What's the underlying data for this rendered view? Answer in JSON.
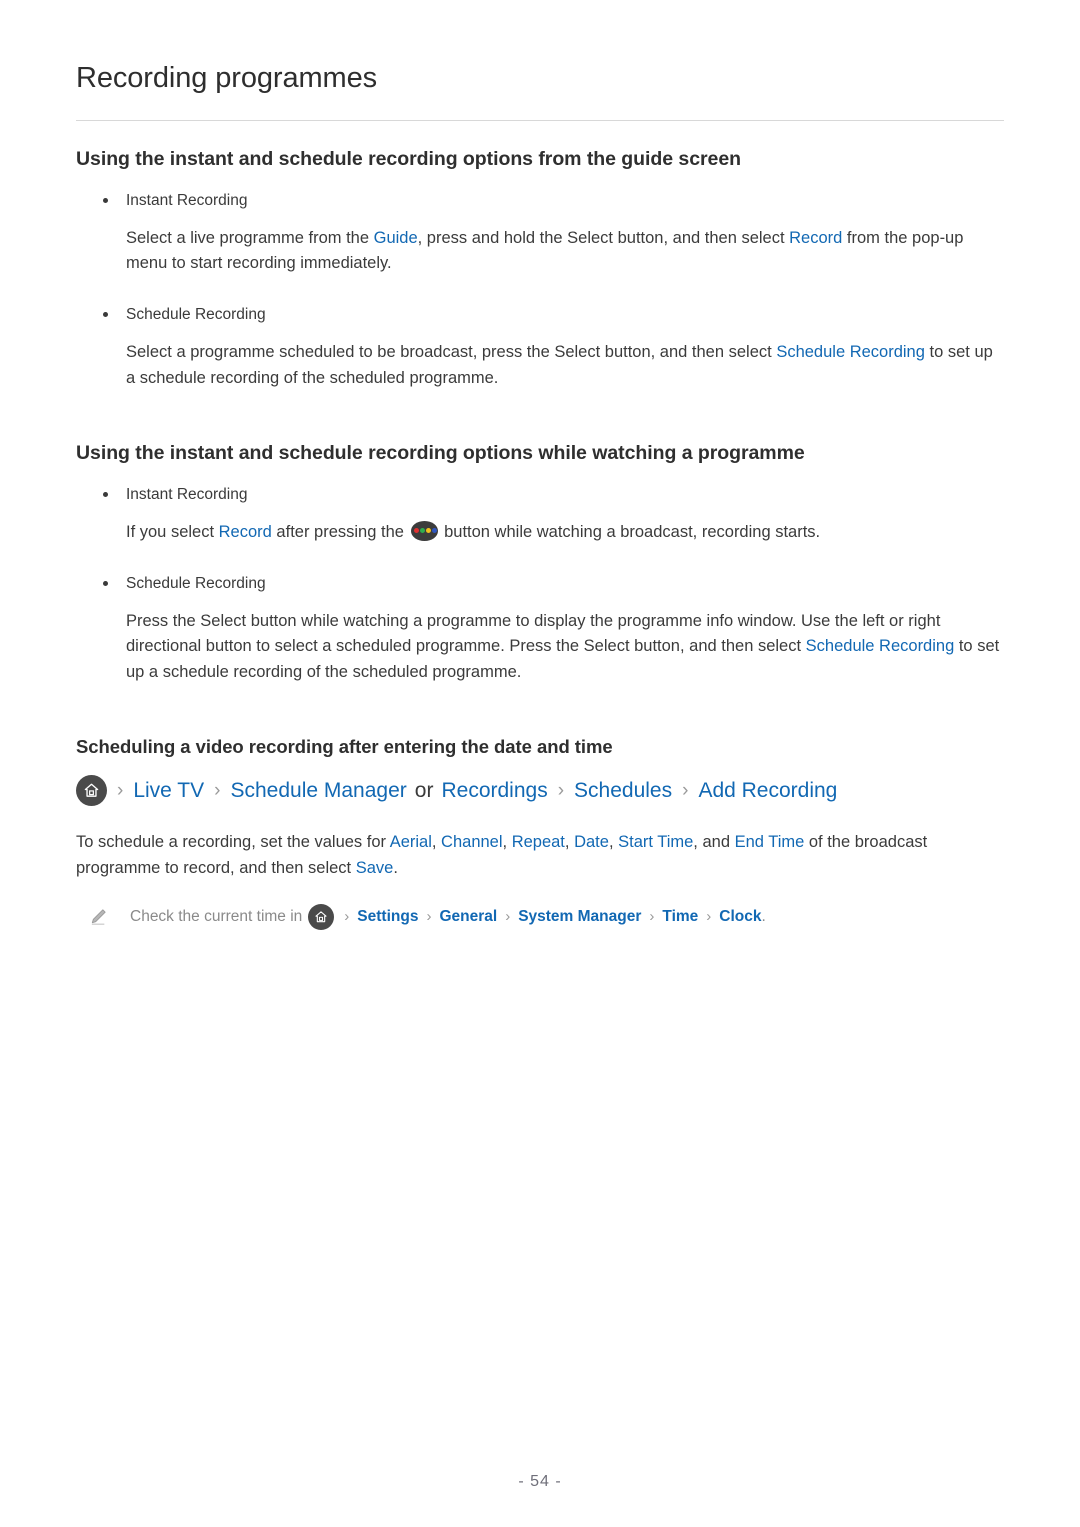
{
  "page": {
    "title": "Recording programmes",
    "footer_page_number": "- 54 -"
  },
  "colors": {
    "link_blue": "#1268b3",
    "body_text": "#3b3b3b",
    "note_gray": "#8a8a8a",
    "icon_circle": "#4a4a4a",
    "dot_red": "#e03030",
    "dot_green": "#2fae4e",
    "dot_yellow": "#f0c020",
    "dot_blue": "#2f56c0"
  },
  "sections": [
    {
      "heading": "Using the instant and schedule recording options from the guide screen",
      "items": [
        {
          "bullet": "Instant Recording",
          "paragraph": {
            "p1": "Select a live programme from the ",
            "link1": "Guide",
            "p2": ", press and hold the Select button, and then select ",
            "link2": "Record",
            "p3": " from the pop-up menu to start recording immediately."
          }
        },
        {
          "bullet": "Schedule Recording",
          "paragraph": {
            "p1": "Select a programme scheduled to be broadcast, press the Select button, and then select ",
            "link1": "Schedule Recording",
            "p2": " to set up a schedule recording of the scheduled programme."
          }
        }
      ]
    },
    {
      "heading": "Using the instant and schedule recording options while watching a programme",
      "items": [
        {
          "bullet": "Instant Recording",
          "paragraph": {
            "p1": "If you select ",
            "link1": "Record",
            "p2": " after pressing the ",
            "icon": "colour-buttons-icon",
            "p3": " button while watching a broadcast, recording starts."
          }
        },
        {
          "bullet": "Schedule Recording",
          "paragraph": {
            "p1": "Press the Select button while watching a programme to display the programme info window. Use the left or right directional button to select a scheduled programme. Press the Select button, and then select ",
            "link1": "Schedule Recording",
            "p2": " to set up a schedule recording of the scheduled programme."
          }
        }
      ]
    },
    {
      "heading": "Scheduling a video recording after entering the date and time"
    }
  ],
  "breadcrumb": {
    "home_icon": "home-icon",
    "separator": "›",
    "crumbs": [
      {
        "label": "Live TV",
        "type": "link"
      },
      {
        "label": "Schedule Manager",
        "type": "link"
      },
      {
        "label": "or",
        "type": "plain"
      },
      {
        "label": "Recordings",
        "type": "link"
      },
      {
        "label": "Schedules",
        "type": "link"
      },
      {
        "label": "Add Recording",
        "type": "link"
      }
    ]
  },
  "schedule_paragraph": {
    "p1": "To schedule a recording, set the values for ",
    "link_aerial": "Aerial",
    "sep1": ", ",
    "link_channel": "Channel",
    "sep2": ", ",
    "link_repeat": "Repeat",
    "sep3": ", ",
    "link_date": "Date",
    "sep4": ", ",
    "link_start_time": "Start Time",
    "p2": ", and ",
    "link_end_time": "End Time",
    "p3": " of the broadcast programme to record, and then select ",
    "link_save": "Save",
    "p4": "."
  },
  "note": {
    "icon": "pencil-icon",
    "text": "Check the current time in",
    "home_icon": "home-icon",
    "separator": "›",
    "crumbs": [
      "Settings",
      "General",
      "System Manager",
      "Time",
      "Clock"
    ],
    "trailing": "."
  }
}
